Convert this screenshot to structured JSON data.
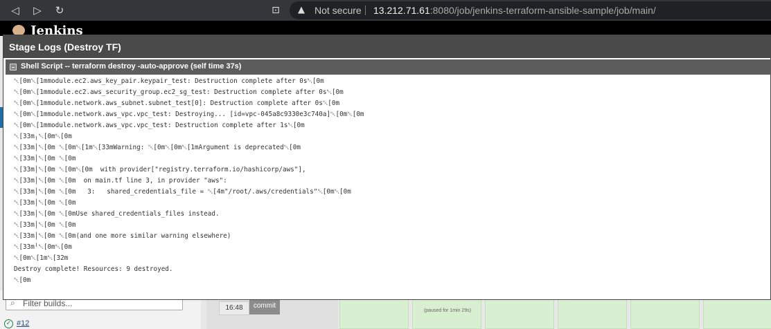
{
  "browser": {
    "not_secure_label": "Not secure",
    "url_host": "13.212.71.61",
    "url_rest": ":8080/job/jenkins-terraform-ansible-sample/job/main/"
  },
  "jenkins": {
    "title": "Jenkins"
  },
  "background": {
    "filter_placeholder": "Filter builds...",
    "build_number": "#12",
    "stage_time": "16:48",
    "commit_label": "commit",
    "paused_text": "(paused for 1min 29s)"
  },
  "modal": {
    "title": "Stage Logs (Destroy TF)",
    "step_title": "Shell Script -- terraform destroy -auto-approve (self time 37s)",
    "log_lines": [
      "\u001b[0m\u001b[1mmodule.ec2.aws_key_pair.keypair_test: Destruction complete after 0s\u001b[0m",
      "\u001b[0m\u001b[1mmodule.ec2.aws_security_group.ec2_sg_test: Destruction complete after 0s\u001b[0m",
      "\u001b[0m\u001b[1mmodule.network.aws_subnet.subnet_test[0]: Destruction complete after 0s\u001b[0m",
      "\u001b[0m\u001b[1mmodule.network.aws_vpc.vpc_test: Destroying... [id=vpc-045a8c9330e3c740a]\u001b[0m\u001b[0m",
      "\u001b[0m\u001b[1mmodule.network.aws_vpc.vpc_test: Destruction complete after 1s\u001b[0m",
      "\u001b[33m╷\u001b[0m\u001b[0m",
      "\u001b[33m│\u001b[0m \u001b[0m\u001b[1m\u001b[33mWarning: \u001b[0m\u001b[0m\u001b[1mArgument is deprecated\u001b[0m",
      "\u001b[33m│\u001b[0m \u001b[0m",
      "\u001b[33m│\u001b[0m \u001b[0m\u001b[0m  with provider[\"registry.terraform.io/hashicorp/aws\"],",
      "\u001b[33m│\u001b[0m \u001b[0m  on main.tf line 3, in provider \"aws\":",
      "\u001b[33m│\u001b[0m \u001b[0m   3:   shared_credentials_file = \u001b[4m\"/root/.aws/credentials\"\u001b[0m\u001b[0m",
      "\u001b[33m│\u001b[0m \u001b[0m",
      "\u001b[33m│\u001b[0m \u001b[0mUse shared_credentials_files instead.",
      "\u001b[33m│\u001b[0m \u001b[0m",
      "\u001b[33m│\u001b[0m \u001b[0m(and one more similar warning elsewhere)",
      "\u001b[33m╵\u001b[0m\u001b[0m",
      "\u001b[0m\u001b[1m\u001b[32m",
      "Destroy complete! Resources: 9 destroyed.",
      "\u001b[0m"
    ]
  }
}
